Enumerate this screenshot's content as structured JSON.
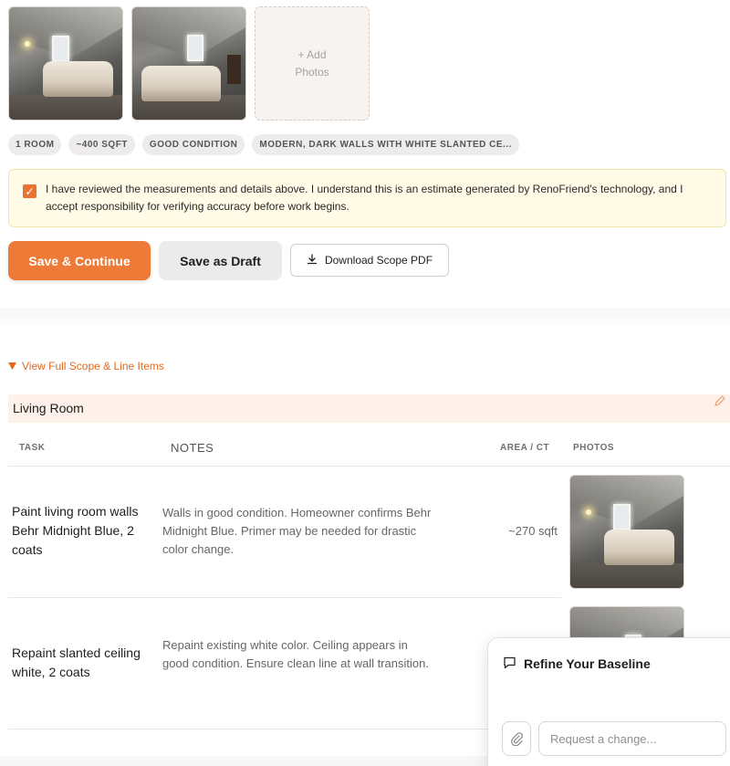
{
  "gallery": {
    "add_photos_line1": "+ Add",
    "add_photos_line2": "Photos"
  },
  "tags": [
    "1 ROOM",
    "~400 SQFT",
    "GOOD CONDITION",
    "MODERN, DARK WALLS WITH WHITE SLANTED CE..."
  ],
  "review": {
    "checked": true,
    "text": "I have reviewed the measurements and details above. I understand this is an estimate generated by RenoFriend's technology, and I accept responsibility for verifying accuracy before work begins."
  },
  "actions": {
    "save_continue": "Save & Continue",
    "save_draft": "Save as Draft",
    "download_pdf": "Download Scope PDF"
  },
  "scope": {
    "toggle_label": "View Full Scope & Line Items",
    "room": {
      "title": "Living Room",
      "columns": {
        "task": "TASK",
        "notes": "NOTES",
        "area": "AREA / CT",
        "photos": "PHOTOS"
      },
      "items": [
        {
          "task": "Paint living room walls Behr Midnight Blue, 2 coats",
          "notes": "Walls in good condition. Homeowner confirms Behr Midnight Blue. Primer may be needed for drastic color change.",
          "area": "~270 sqft"
        },
        {
          "task": "Repaint slanted ceiling white, 2 coats",
          "notes": "Repaint existing white color. Ceiling appears in good condition. Ensure clean line at wall transition.",
          "area": ""
        }
      ]
    }
  },
  "chat": {
    "title": "Refine Your Baseline",
    "placeholder": "Request a change..."
  },
  "colors": {
    "accent": "#ed7a37",
    "accent_text": "#e2691f",
    "review_bg": "#fffbe6",
    "room_header_bg": "#fdf1ea"
  },
  "icons": [
    "checkbox-checked-icon",
    "download-icon",
    "triangle-down-icon",
    "pencil-icon",
    "chat-bubble-icon",
    "paperclip-icon"
  ]
}
